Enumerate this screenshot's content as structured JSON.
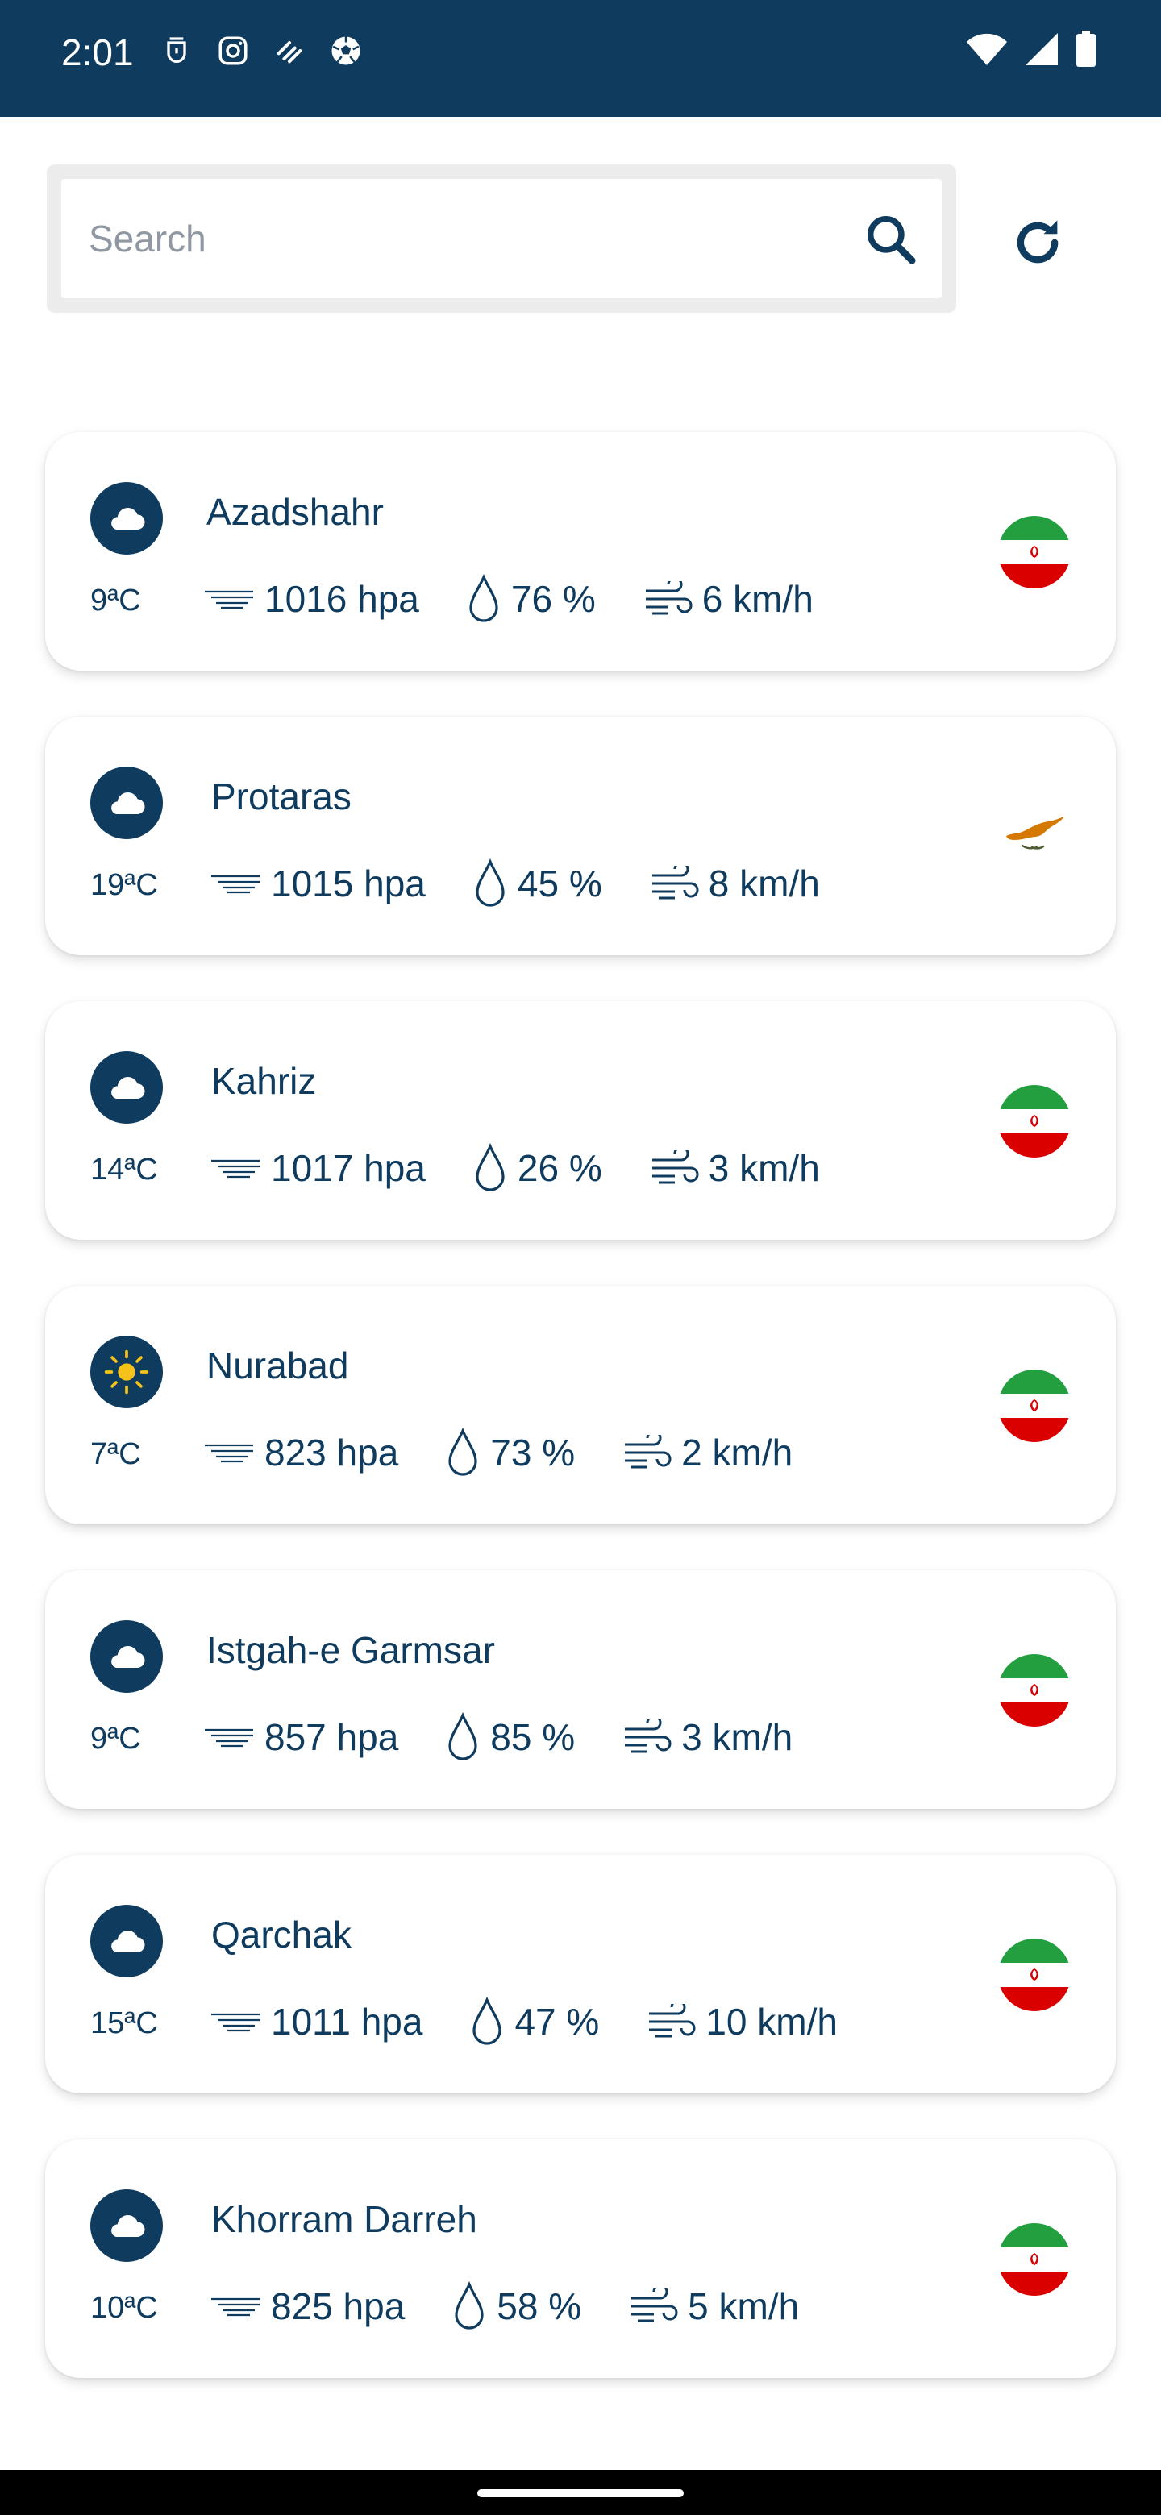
{
  "status_bar": {
    "time": "2:01",
    "left_icons": [
      "alarm-icon",
      "instagram-icon",
      "app-icon",
      "soccer-icon"
    ],
    "right_icons": [
      "wifi-icon",
      "signal-icon",
      "battery-icon"
    ]
  },
  "search": {
    "placeholder": "Search",
    "value": ""
  },
  "colors": {
    "primary": "#0f3b5e",
    "card_bg": "#ffffff",
    "iran_green": "#239f40",
    "iran_red": "#da0000",
    "cyprus_orange": "#d57800"
  },
  "cities": [
    {
      "name": "Azadshahr",
      "temp": "9ªC",
      "pressure": "1016 hpa",
      "humidity": "76 %",
      "wind": "6 km/h",
      "weather_icon": "cloud-icon",
      "flag": "iran"
    },
    {
      "name": "Protaras",
      "temp": "19ªC",
      "pressure": "1015 hpa",
      "humidity": "45 %",
      "wind": "8 km/h",
      "weather_icon": "cloud-icon",
      "flag": "cyprus"
    },
    {
      "name": "Kahriz",
      "temp": "14ªC",
      "pressure": "1017 hpa",
      "humidity": "26 %",
      "wind": "3 km/h",
      "weather_icon": "cloud-icon",
      "flag": "iran"
    },
    {
      "name": "Nurabad",
      "temp": "7ªC",
      "pressure": "823 hpa",
      "humidity": "73 %",
      "wind": "2 km/h",
      "weather_icon": "sun-icon",
      "flag": "iran"
    },
    {
      "name": "Istgah-e Garmsar",
      "temp": "9ªC",
      "pressure": "857 hpa",
      "humidity": "85 %",
      "wind": "3 km/h",
      "weather_icon": "cloud-icon",
      "flag": "iran"
    },
    {
      "name": "Qarchak",
      "temp": "15ªC",
      "pressure": "1011 hpa",
      "humidity": "47 %",
      "wind": "10 km/h",
      "weather_icon": "cloud-icon",
      "flag": "iran"
    },
    {
      "name": "Khorram Darreh",
      "temp": "10ªC",
      "pressure": "825 hpa",
      "humidity": "58 %",
      "wind": "5 km/h",
      "weather_icon": "cloud-icon",
      "flag": "iran"
    }
  ]
}
